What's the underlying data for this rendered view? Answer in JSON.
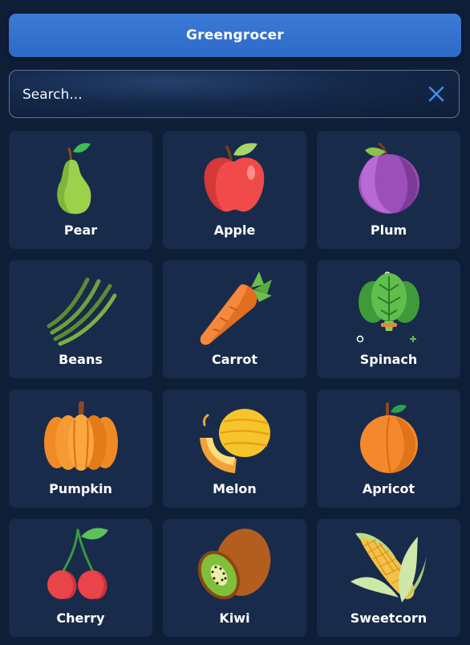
{
  "header": {
    "title": "Greengrocer"
  },
  "search": {
    "placeholder": "Search...",
    "value": ""
  },
  "colors": {
    "background": "#0f1e37",
    "card": "#182b4b",
    "header": "#3377d0",
    "accent": "#3b8fe8"
  },
  "items": [
    {
      "label": "Pear",
      "icon": "pear-icon"
    },
    {
      "label": "Apple",
      "icon": "apple-icon"
    },
    {
      "label": "Plum",
      "icon": "plum-icon"
    },
    {
      "label": "Beans",
      "icon": "beans-icon"
    },
    {
      "label": "Carrot",
      "icon": "carrot-icon"
    },
    {
      "label": "Spinach",
      "icon": "spinach-icon"
    },
    {
      "label": "Pumpkin",
      "icon": "pumpkin-icon"
    },
    {
      "label": "Melon",
      "icon": "melon-icon"
    },
    {
      "label": "Apricot",
      "icon": "apricot-icon"
    },
    {
      "label": "Cherry",
      "icon": "cherry-icon"
    },
    {
      "label": "Kiwi",
      "icon": "kiwi-icon"
    },
    {
      "label": "Sweetcorn",
      "icon": "sweetcorn-icon"
    }
  ]
}
